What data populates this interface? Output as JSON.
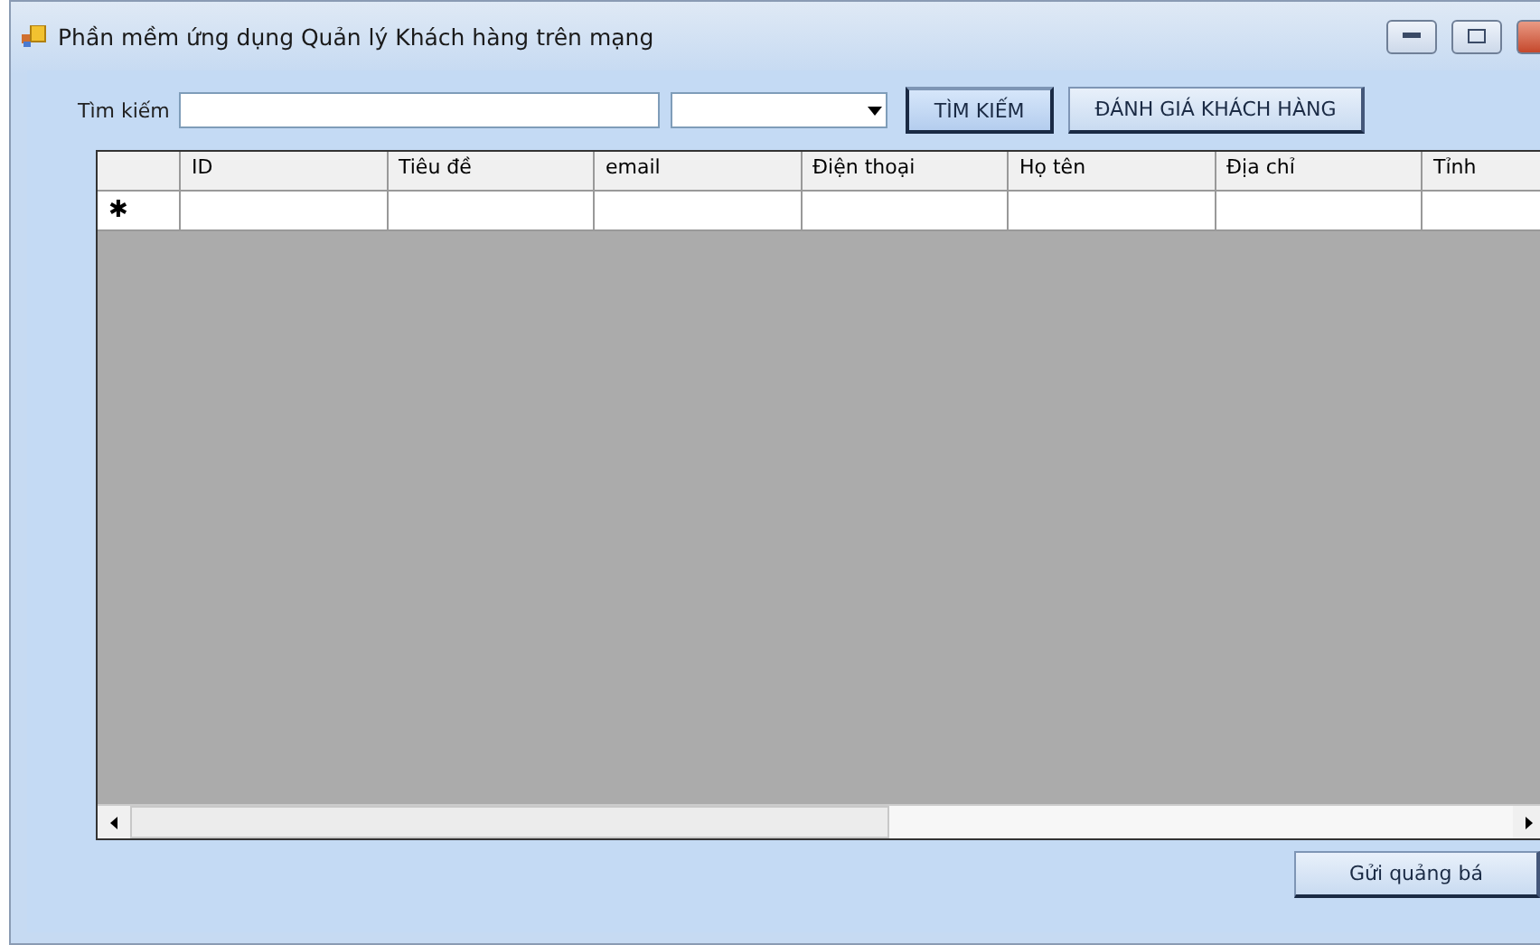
{
  "window": {
    "title": "Phần mềm ứng dụng Quản lý Khách hàng trên mạng"
  },
  "search": {
    "label": "Tìm kiếm"
  },
  "buttons": [
    {
      "label": "TÌM KIẾM",
      "selected": true
    },
    {
      "label": "ĐÁNH GIÁ KHÁCH HÀNG",
      "selected": false
    }
  ],
  "table": {
    "columns": [
      "ID",
      "Tiêu đề",
      "email",
      "Điện thoại",
      "Họ tên",
      "Địa chỉ",
      "Tỉnh"
    ],
    "new_row_marker": "✱"
  },
  "footer_button": "Gửi quảng bá"
}
